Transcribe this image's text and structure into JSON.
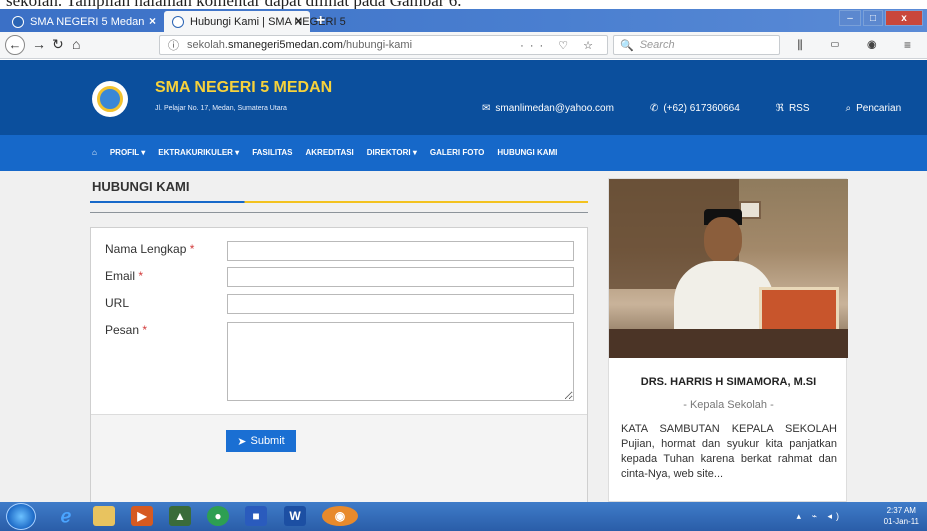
{
  "document_caption": "sekolah. Tampilan halaman komentar dapat dilihat pada Gambar 6.",
  "browser": {
    "tabs": [
      {
        "label": "SMA NEGERI 5 Medan",
        "active": false
      },
      {
        "label": "Hubungi Kami | SMA NEGERI 5",
        "active": true
      }
    ],
    "url_prefix": "sekolah.",
    "url_host": "smanegeri5medan.com",
    "url_path": "/hubungi-kami",
    "url_actions": "··· ♡ ☆",
    "search_placeholder": "Search"
  },
  "site": {
    "name": "SMA NEGERI 5 MEDAN",
    "address": "Jl. Pelajar No. 17, Medan, Sumatera Utara",
    "email": "smanlimedan@yahoo.com",
    "phone": "(+62) 617360664",
    "rss": "RSS",
    "search": "Pencarian"
  },
  "menu": [
    "PROFIL ▾",
    "EKTRAKURIKULER ▾",
    "FASILITAS",
    "AKREDITASI",
    "DIREKTORI ▾",
    "GALERI FOTO",
    "HUBUNGI KAMI"
  ],
  "page": {
    "title": "HUBUNGI KAMI",
    "fields": {
      "name_label": "Nama Lengkap",
      "email_label": "Email",
      "url_label": "URL",
      "message_label": "Pesan",
      "required_mark": "*"
    },
    "submit_label": "Submit"
  },
  "sidebar": {
    "name": "DRS. HARRIS H SIMAMORA, M.SI",
    "role": "- Kepala Sekolah -",
    "text": "KATA SAMBUTAN KEPALA SEKOLAH Pujian, hormat dan syukur kita panjatkan kepada Tuhan karena berkat rahmat dan cinta-Nya, web site..."
  },
  "taskbar": {
    "time": "2:37 AM",
    "date": "01-Jan-11"
  },
  "colors": {
    "header_blue": "#0b4f9d",
    "menu_blue": "#1668c9",
    "site_title_yellow": "#f7d23b",
    "accent_yellow": "#f3c21f",
    "required_red": "#d23b3b"
  }
}
